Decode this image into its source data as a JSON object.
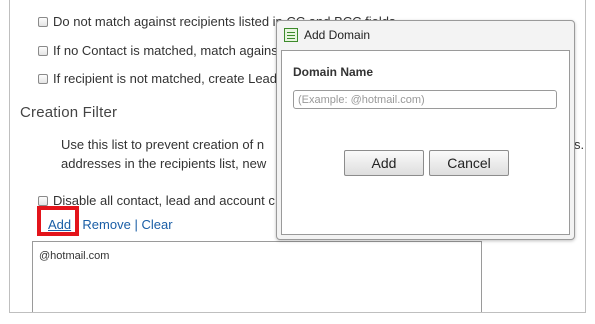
{
  "options": {
    "items": [
      {
        "label": "Do not match against recipients listed in CC and BCC fields",
        "checked": false
      },
      {
        "label": "If no Contact is matched, match against Leads",
        "checked": false
      },
      {
        "label": "If recipient is not matched, create Lead",
        "checked": false
      }
    ]
  },
  "creation_filter": {
    "title": "Creation Filter",
    "description_line1": "Use this list to prevent creation of n",
    "description_line2": "addresses in the recipients list, new",
    "description_tail": "s.",
    "disable_label": "Disable all contact, lead and account c",
    "links": {
      "add": "Add",
      "remove": "Remove",
      "clear": "Clear",
      "separator": "|"
    },
    "domains": [
      "@hotmail.com"
    ]
  },
  "dialog": {
    "title": "Add Domain",
    "field_label": "Domain Name",
    "field_value": "",
    "field_placeholder": "(Example: @hotmail.com)",
    "add_button": "Add",
    "cancel_button": "Cancel"
  },
  "colors": {
    "link": "#1a5ea6",
    "highlight": "#e3141b",
    "dialog_bg": "#f3f3f3"
  }
}
